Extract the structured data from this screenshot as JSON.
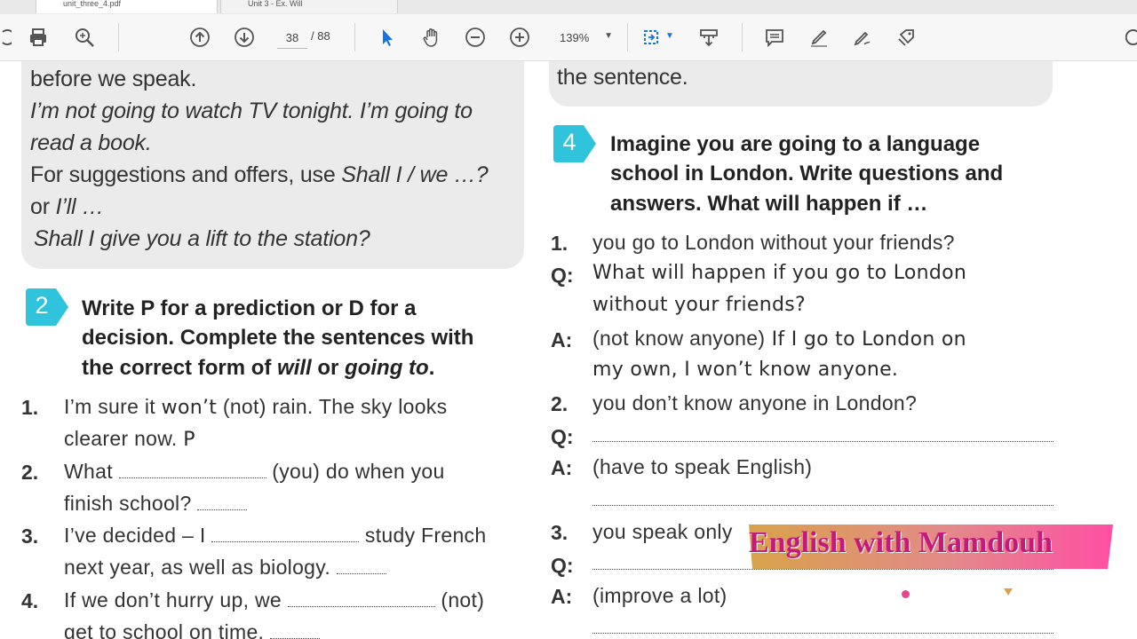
{
  "tabs": [
    {
      "label": "unit_three_4.pdf"
    },
    {
      "label": "Unit 3 - Ex. Will"
    }
  ],
  "toolbar": {
    "page_current": "38",
    "page_total": "/ 88",
    "zoom": "139%",
    "icons": [
      "back-icon",
      "print-icon",
      "search-icon",
      "previous-page-icon",
      "next-page-icon",
      "zoom-out-icon",
      "zoom-in-icon",
      "select-cursor-icon",
      "hand-icon",
      "fit-page-icon",
      "scroll-mode-icon",
      "comment-icon",
      "highlight-icon",
      "sign-icon",
      "share-icon",
      "more-icon"
    ]
  },
  "grammar_left": {
    "l1": "before we speak.",
    "l2": "I’m not going to watch TV tonight. I’m going to",
    "l3": "read a book.",
    "l4a": "For suggestions and offers, use ",
    "l4b": "Shall I / we …?",
    "l5a": "or ",
    "l5b": "I’ll …",
    "l6": "Shall I give you a lift to the station?"
  },
  "grammar_right": {
    "l1": "the sentence."
  },
  "exercise2": {
    "badge": "2",
    "title_l1": "Write P for a prediction or D for a",
    "title_l2": "decision. Complete the sentences with",
    "title_l3a": "the correct form of ",
    "title_l3b": "will",
    "title_l3c": " or ",
    "title_l3d": "going to",
    "title_l3e": ".",
    "items": [
      {
        "num": "1.",
        "a": "I’m sure it ",
        "ans": "won’t",
        "b": " (not) rain. The sky looks",
        "c": "clearer now. ",
        "pd": "P"
      },
      {
        "num": "2.",
        "a": "What ",
        "b": " (you) do when you",
        "c": "finish school? "
      },
      {
        "num": "3.",
        "a": "I’ve decided – I ",
        "b": " study French",
        "c": "next year, as well as biology. "
      },
      {
        "num": "4.",
        "a": "If we don’t hurry up, we ",
        "b": " (not)",
        "c": "get to school on time. "
      }
    ]
  },
  "exercise4": {
    "badge": "4",
    "title_l1": "Imagine you are going to a language",
    "title_l2": "school in London. Write questions and",
    "title_l3": "answers. What will happen if …",
    "items": [
      {
        "num": "1.",
        "prompt": "you go to London without your friends?",
        "q_label": "Q:",
        "q_l1": "What will happen if you go to London",
        "q_l2": "without your friends?",
        "a_label": "A:",
        "a_hint": "(not know anyone)",
        "a_l1": " If I go to London on",
        "a_l2": "my own, I won’t know anyone."
      },
      {
        "num": "2.",
        "prompt": "you don’t know anyone in London?",
        "q_label": "Q:",
        "a_label": "A:",
        "a_hint": "(have to speak English)"
      },
      {
        "num": "3.",
        "prompt": "you speak only",
        "q_label": "Q:",
        "a_label": "A:",
        "a_hint": "(improve a lot)"
      }
    ]
  },
  "watermark": {
    "text": "English with Mamdouh",
    "colors": {
      "text": "#c61a7a",
      "band_left": "#d8a24a",
      "band_right": "#ff4fa3"
    }
  },
  "colors": {
    "badge": "#2fc3dc",
    "grammar_box": "#ebebeb",
    "toolbar": "#f7f7f7"
  }
}
